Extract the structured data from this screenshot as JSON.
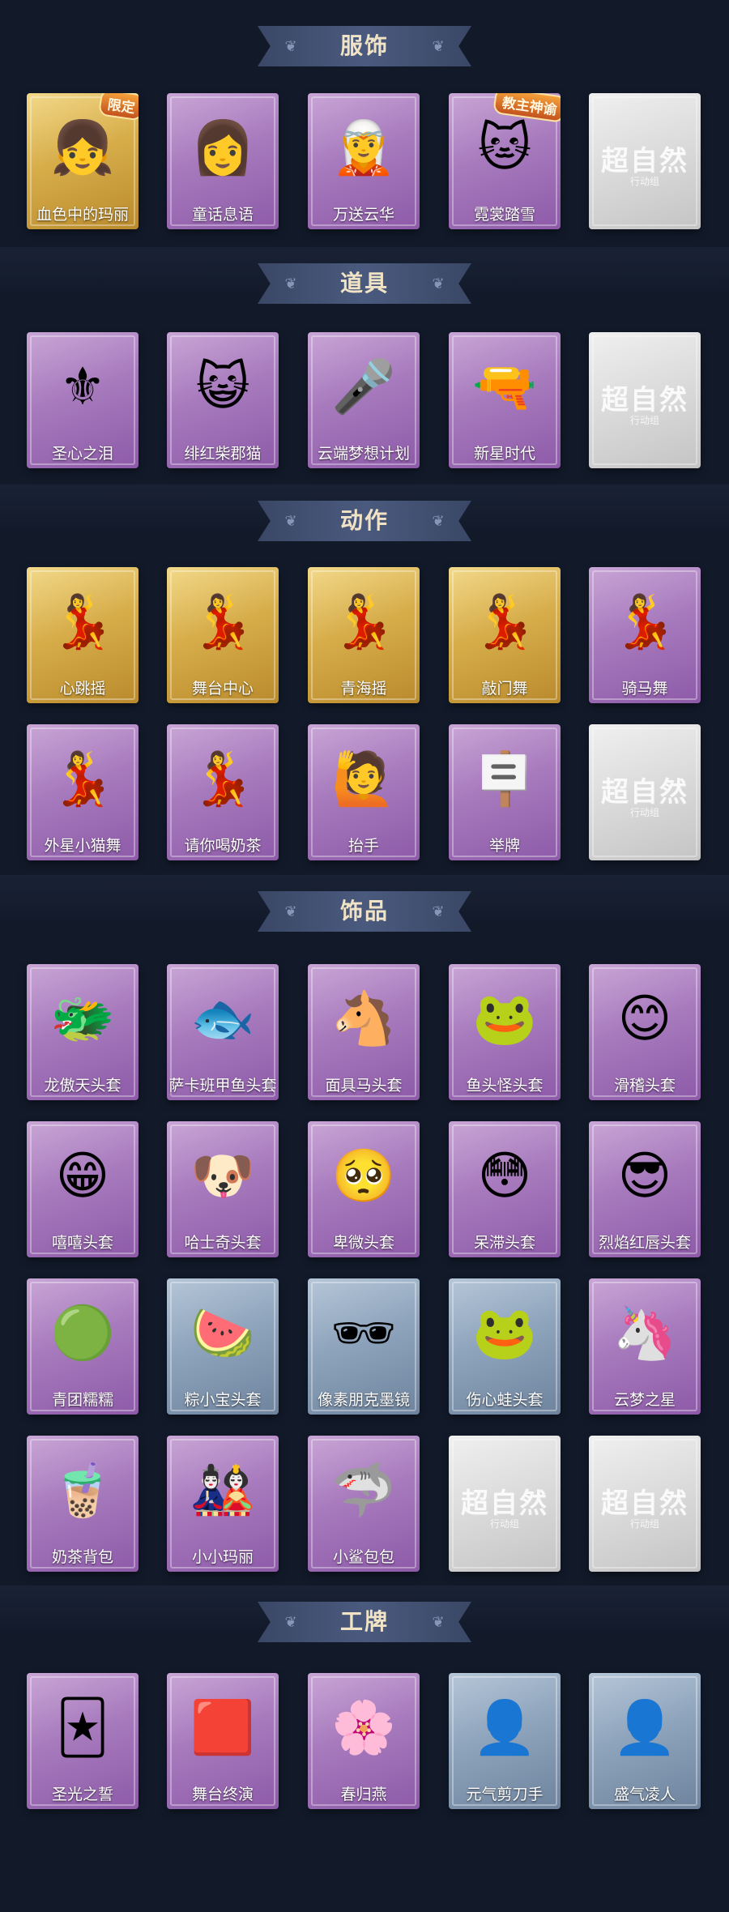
{
  "sections": [
    {
      "title": "服饰",
      "items": [
        {
          "label": "血色中的玛丽",
          "theme": "gold",
          "icon": "doll-portrait-icon",
          "badge": "限定"
        },
        {
          "label": "童话息语",
          "theme": "purple",
          "icon": "girl-portrait-icon"
        },
        {
          "label": "万送云华",
          "theme": "purple",
          "icon": "silver-hair-portrait-icon"
        },
        {
          "label": "霓裳踏雪",
          "theme": "purple",
          "icon": "cat-ears-portrait-icon",
          "badge": "教主神谕"
        },
        {
          "label": "",
          "theme": "gray",
          "placeholder": "超自然",
          "placeholder_sub": "行动组"
        }
      ]
    },
    {
      "title": "道具",
      "items": [
        {
          "label": "圣心之泪",
          "theme": "purple",
          "icon": "scepter-icon"
        },
        {
          "label": "绯红柴郡猫",
          "theme": "purple",
          "icon": "red-cat-icon"
        },
        {
          "label": "云端梦想计划",
          "theme": "purple",
          "icon": "microphone-wand-icon"
        },
        {
          "label": "新星时代",
          "theme": "purple",
          "icon": "revolver-icon"
        },
        {
          "label": "",
          "theme": "gray",
          "placeholder": "超自然",
          "placeholder_sub": "行动组"
        }
      ]
    },
    {
      "title": "动作",
      "items": [
        {
          "label": "心跳摇",
          "theme": "gold",
          "icon": "dance-pose-icon"
        },
        {
          "label": "舞台中心",
          "theme": "gold",
          "icon": "dance-pose-icon"
        },
        {
          "label": "青海摇",
          "theme": "gold",
          "icon": "dance-pose-icon"
        },
        {
          "label": "敲门舞",
          "theme": "gold",
          "icon": "dance-pose-icon"
        },
        {
          "label": "骑马舞",
          "theme": "purple",
          "icon": "dance-pose-icon"
        },
        {
          "label": "外星小猫舞",
          "theme": "purple",
          "icon": "dance-pose-icon"
        },
        {
          "label": "请你喝奶茶",
          "theme": "purple",
          "icon": "dance-pose-icon"
        },
        {
          "label": "抬手",
          "theme": "purple",
          "icon": "raise-hand-pose-icon"
        },
        {
          "label": "举牌",
          "theme": "purple",
          "icon": "hold-sign-pose-icon"
        },
        {
          "label": "",
          "theme": "gray",
          "placeholder": "超自然",
          "placeholder_sub": "行动组"
        }
      ]
    },
    {
      "title": "饰品",
      "items": [
        {
          "label": "龙傲天头套",
          "theme": "purple",
          "icon": "dragon-head-icon"
        },
        {
          "label": "萨卡班甲鱼头套",
          "theme": "purple",
          "icon": "fish-head-icon"
        },
        {
          "label": "面具马头套",
          "theme": "purple",
          "icon": "horse-head-icon"
        },
        {
          "label": "鱼头怪头套",
          "theme": "purple",
          "icon": "green-fish-head-icon"
        },
        {
          "label": "滑稽头套",
          "theme": "purple",
          "icon": "smile-face-icon"
        },
        {
          "label": "嘻嘻头套",
          "theme": "purple",
          "icon": "grin-face-icon"
        },
        {
          "label": "哈士奇头套",
          "theme": "purple",
          "icon": "husky-head-icon"
        },
        {
          "label": "卑微头套",
          "theme": "purple",
          "icon": "humble-face-icon"
        },
        {
          "label": "呆滞头套",
          "theme": "purple",
          "icon": "dazed-face-icon"
        },
        {
          "label": "烈焰红唇头套",
          "theme": "purple",
          "icon": "yellow-mascot-icon"
        },
        {
          "label": "青团糯糯",
          "theme": "purple",
          "icon": "green-blob-icon"
        },
        {
          "label": "粽小宝头套",
          "theme": "blue",
          "icon": "melon-head-icon"
        },
        {
          "label": "像素朋克墨镜",
          "theme": "blue",
          "icon": "pixel-sunglasses-icon"
        },
        {
          "label": "伤心蛙头套",
          "theme": "blue",
          "icon": "sad-frog-icon"
        },
        {
          "label": "云梦之星",
          "theme": "purple",
          "icon": "unicorn-cloud-icon"
        },
        {
          "label": "奶茶背包",
          "theme": "purple",
          "icon": "milk-tea-bag-icon"
        },
        {
          "label": "小小玛丽",
          "theme": "purple",
          "icon": "mini-doll-icon"
        },
        {
          "label": "小鲨包包",
          "theme": "purple",
          "icon": "shark-bag-icon"
        },
        {
          "label": "",
          "theme": "gray",
          "placeholder": "超自然",
          "placeholder_sub": "行动组"
        },
        {
          "label": "",
          "theme": "gray",
          "placeholder": "超自然",
          "placeholder_sub": "行动组"
        }
      ]
    },
    {
      "title": "工牌",
      "items": [
        {
          "label": "圣光之誓",
          "theme": "purple",
          "icon": "gold-card-icon"
        },
        {
          "label": "舞台终演",
          "theme": "purple",
          "icon": "red-card-icon"
        },
        {
          "label": "春归燕",
          "theme": "purple",
          "icon": "pink-card-icon"
        },
        {
          "label": "元气剪刀手",
          "theme": "blue",
          "icon": "silhouette-card-icon"
        },
        {
          "label": "盛气凌人",
          "theme": "blue",
          "icon": "silhouette-card-icon"
        }
      ]
    }
  ],
  "colors": {
    "background": "#121a2a",
    "banner": "#3a4766",
    "title_text": "#f1e3c6",
    "purple": "#a77abd",
    "gold": "#d7ad4a",
    "blue": "#8ea4bc",
    "gray": "#dadada"
  }
}
